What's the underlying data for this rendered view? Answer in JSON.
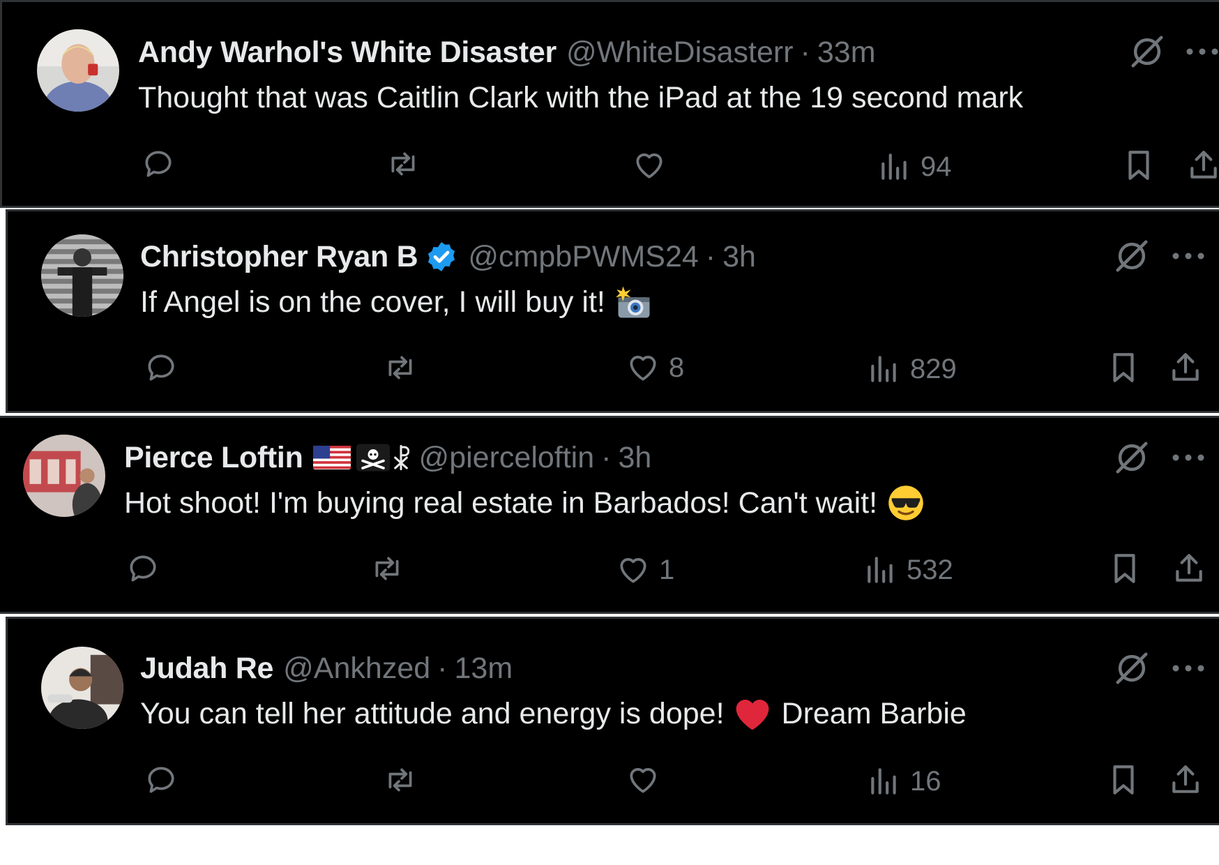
{
  "tweets": [
    {
      "display_name": "Andy Warhol's White Disaster",
      "handle": "@WhiteDisasterr",
      "separator": "·",
      "time": "33m",
      "text": "Thought that was Caitlin Clark with the iPad at the 19 second mark",
      "replies": "",
      "retweets": "",
      "likes": "",
      "views": "94",
      "verified": false,
      "name_emojis": []
    },
    {
      "display_name": "Christopher Ryan B",
      "handle": "@cmpbPWMS24",
      "separator": "·",
      "time": "3h",
      "text": "If Angel is on the cover, I will buy it!",
      "text_emoji": "camera-with-flash",
      "replies": "",
      "retweets": "",
      "likes": "8",
      "views": "829",
      "verified": true,
      "verified_color": "#1d9bf0",
      "name_emojis": []
    },
    {
      "display_name": "Pierce Loftin",
      "handle": "@pierceloftin",
      "separator": "·",
      "time": "3h",
      "text": "Hot shoot! I'm buying real estate in Barbados! Can't wait!",
      "text_emoji": "smiling-face-with-sunglasses",
      "replies": "",
      "retweets": "",
      "likes": "1",
      "views": "532",
      "verified": false,
      "name_emojis": [
        "us-flag",
        "pirate-flag",
        "chi-rho-symbol"
      ]
    },
    {
      "display_name": "Judah Re",
      "handle": "@Ankhzed",
      "separator": "·",
      "time": "13m",
      "text": "You can tell her attitude and energy is dope!",
      "text_emoji": "red-heart",
      "text_after": "Dream Barbie",
      "replies": "",
      "retweets": "",
      "likes": "",
      "views": "16",
      "verified": false,
      "name_emojis": []
    }
  ],
  "colors": {
    "background": "#000000",
    "primary_text": "#e7e9ea",
    "secondary_text": "#71767b",
    "divider": "#2f3336",
    "verified_blue": "#1d9bf0"
  },
  "icons": {
    "reply": "speech-bubble-icon",
    "retweet": "retweet-arrows-icon",
    "like": "heart-outline-icon",
    "views": "bar-chart-icon",
    "bookmark": "bookmark-icon",
    "share": "share-upload-icon",
    "grok": "grok-slash-circle-icon",
    "more": "more-dots-icon"
  }
}
